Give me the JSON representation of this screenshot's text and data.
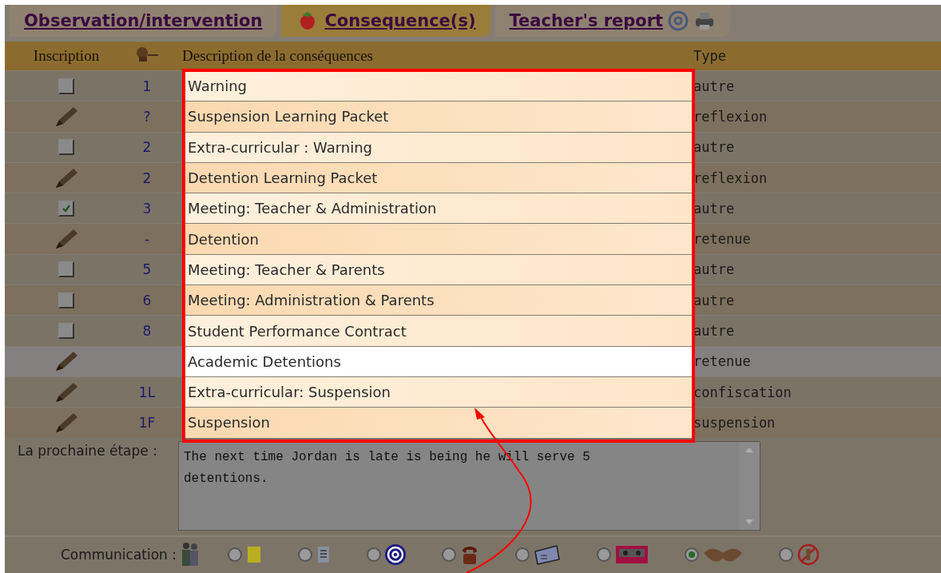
{
  "tabs": [
    {
      "label": "Observation/intervention",
      "selected": false
    },
    {
      "label": "Consequence(s)",
      "selected": true
    },
    {
      "label": "Teacher's report",
      "selected": false
    }
  ],
  "table": {
    "columns": [
      "Inscription",
      "Description de la conséquences",
      "Type"
    ],
    "rows": [
      {
        "kind": "checkbox",
        "checked": false,
        "number": "1",
        "description": "Warning",
        "type": "autre",
        "selected": false
      },
      {
        "kind": "pencil",
        "number": "?",
        "description": "Suspension Learning Packet",
        "type": "reflexion",
        "selected": false
      },
      {
        "kind": "checkbox",
        "checked": false,
        "number": "2",
        "description": "Extra-curricular : Warning",
        "type": "autre",
        "selected": false
      },
      {
        "kind": "pencil",
        "number": "2",
        "description": "Detention Learning Packet",
        "type": "reflexion",
        "selected": false
      },
      {
        "kind": "checkbox",
        "checked": true,
        "number": "3",
        "description": "Meeting: Teacher & Administration",
        "type": "autre",
        "selected": false
      },
      {
        "kind": "pencil",
        "number": "-",
        "description": "Detention",
        "type": "retenue",
        "selected": false
      },
      {
        "kind": "checkbox",
        "checked": false,
        "number": "5",
        "description": "Meeting: Teacher & Parents",
        "type": "autre",
        "selected": false
      },
      {
        "kind": "checkbox",
        "checked": false,
        "number": "6",
        "description": "Meeting: Administration & Parents",
        "type": "autre",
        "selected": false
      },
      {
        "kind": "checkbox",
        "checked": false,
        "number": "8",
        "description": "Student Performance Contract",
        "type": "autre",
        "selected": false
      },
      {
        "kind": "pencil",
        "description": "Academic Detentions",
        "type": "retenue",
        "selected": true
      },
      {
        "kind": "pencil",
        "number": "1L",
        "description": "Extra-curricular: Suspension",
        "type": "confiscation",
        "selected": false
      },
      {
        "kind": "pencil",
        "number": "1F",
        "description": "Suspension",
        "type": "suspension",
        "selected": false
      }
    ]
  },
  "next_step": {
    "label": "La prochaine étape :",
    "value": "The next time Jordan is late is being he will serve 5 detentions."
  },
  "communication": {
    "label": "Communication :",
    "options": [
      {
        "selected": false
      },
      {
        "selected": false
      },
      {
        "selected": false
      },
      {
        "selected": false
      },
      {
        "selected": false
      },
      {
        "selected": false
      },
      {
        "selected": true
      },
      {
        "selected": false
      }
    ]
  }
}
